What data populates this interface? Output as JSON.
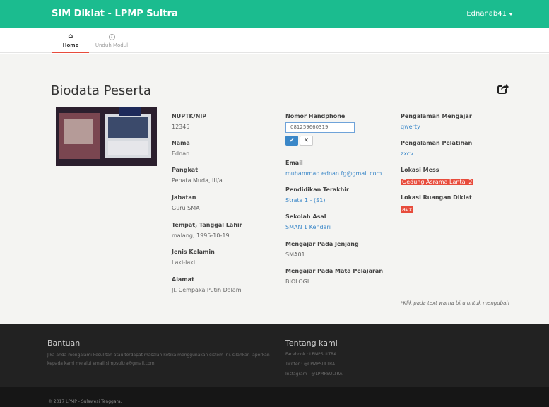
{
  "app": {
    "brand": "SIM Diklat - LPMP Sultra",
    "user": "Ednanab41"
  },
  "nav": {
    "tabs": [
      {
        "label": "Home",
        "icon": "home-icon"
      },
      {
        "label": "Unduh Modul",
        "icon": "download-icon"
      }
    ]
  },
  "page": {
    "title": "Biodata Peserta"
  },
  "col1": [
    {
      "label": "NUPTK/NIP",
      "value": "12345"
    },
    {
      "label": "Nama",
      "value": "Ednan"
    },
    {
      "label": "Pangkat",
      "value": "Penata Muda, III/a"
    },
    {
      "label": "Jabatan",
      "value": "Guru SMA"
    },
    {
      "label": "Tempat, Tanggal Lahir",
      "value": "malang, 1995-10-19"
    },
    {
      "label": "Jenis Kelamin",
      "value": "Laki-laki"
    },
    {
      "label": "Alamat",
      "value": "Jl. Cempaka Putih Dalam"
    }
  ],
  "col2": {
    "phone": {
      "label": "Nomor Handphone",
      "value": "081259660319"
    },
    "fields": [
      {
        "label": "Email",
        "value": "muhammad.ednan.fg@gmail.com"
      },
      {
        "label": "Pendidikan Terakhir",
        "value": "Strata 1 - (S1)"
      },
      {
        "label": "Sekolah Asal",
        "value": "SMAN 1 Kendari"
      },
      {
        "label": "Mengajar Pada Jenjang",
        "value": "SMA01"
      },
      {
        "label": "Mengajar Pada Mata Pelajaran",
        "value": "BIOLOGI"
      }
    ]
  },
  "col3": [
    {
      "label": "Pengalaman Mengajar",
      "value": "qwerty"
    },
    {
      "label": "Pengalaman Pelatihan",
      "value": "zxcv"
    },
    {
      "label": "Lokasi Mess",
      "value": "Gedung Asrama Lantai 2"
    },
    {
      "label": "Lokasi Ruangan Diklat",
      "value": "avx"
    }
  ],
  "note": "*Klik pada text warna biru untuk mengubah",
  "footer": {
    "help_title": "Bantuan",
    "help_text_1": "Jika anda mengalami kesulitan atau terdapat masalah ketika menggunakan sistem ini, silahkan laporkan",
    "help_text_2": "kepada kami melalui email simpsultra@gmail.com",
    "about_title": "Tentang kami",
    "facebook": "Facebook : LPMPSULTRA",
    "twitter": "Twitter : @LPMPSULTRA",
    "instagram": "Instagram : @LPMPSULTRA",
    "copyright": "© 2017 LPMP - Sulawesi Tenggara."
  },
  "colors": {
    "topbar": "#1bbc8f",
    "accent_red": "#e74c3c",
    "link_blue": "#3a87c8",
    "footer": "#222222"
  }
}
